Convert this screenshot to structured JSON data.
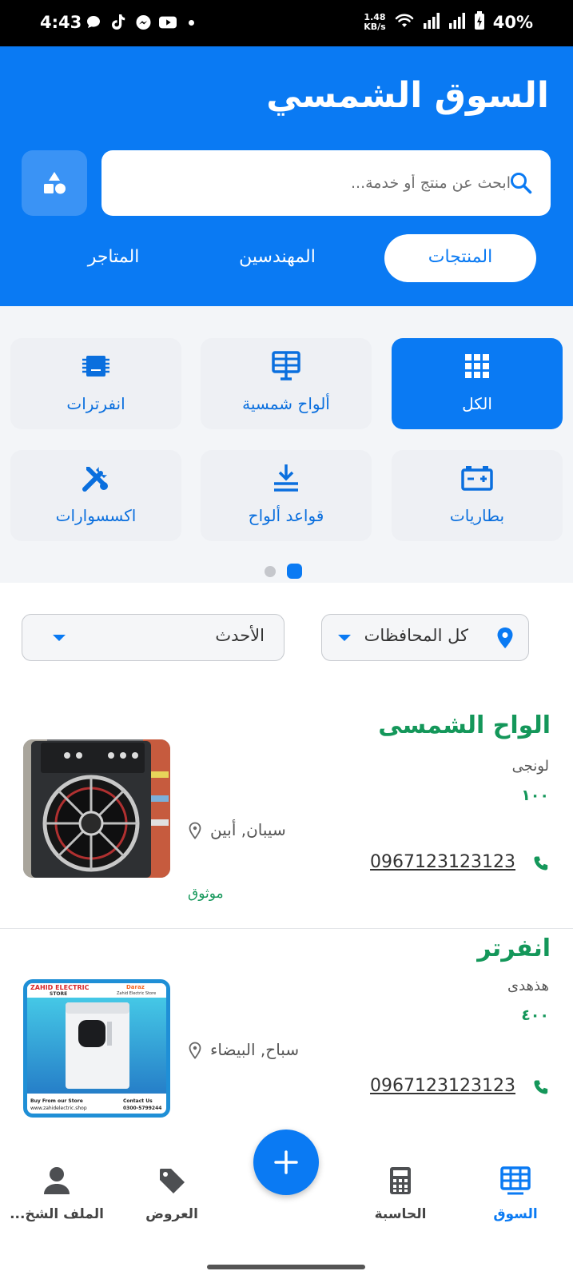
{
  "status_bar": {
    "time": "4:43",
    "speed_value": "1.48",
    "speed_unit": "KB/s",
    "battery": "40%",
    "app_icons": [
      "chat-bubble-icon",
      "tiktok-icon",
      "messenger-icon",
      "youtube-icon"
    ]
  },
  "header": {
    "title": "السوق الشمسي",
    "search_placeholder": "ابحث عن منتج أو خدمة...",
    "tabs": [
      {
        "label": "المنتجات",
        "active": true
      },
      {
        "label": "المهندسين",
        "active": false
      },
      {
        "label": "المتاجر",
        "active": false
      }
    ]
  },
  "categories": [
    {
      "label": "الكل",
      "icon": "grid-icon",
      "active": true
    },
    {
      "label": "ألواح شمسية",
      "icon": "solar-panel-icon",
      "active": false
    },
    {
      "label": "انفرترات",
      "icon": "inverter-chip-icon",
      "active": false
    },
    {
      "label": "بطاريات",
      "icon": "battery-icon",
      "active": false
    },
    {
      "label": "قواعد ألواح",
      "icon": "panel-mount-icon",
      "active": false
    },
    {
      "label": "اكسسوارات",
      "icon": "tools-icon",
      "active": false
    }
  ],
  "filters": {
    "governorate": "كل المحافظات",
    "sort": "الأحدث"
  },
  "listings": [
    {
      "title": "الواح الشمسى",
      "brand": "لونجى",
      "price": "١٠٠",
      "location": "سيبان, أبين",
      "phone": "0967123123123",
      "badge": "موثوق"
    },
    {
      "title": "انفرتر",
      "brand": "هذهدى",
      "price": "٤٠٠",
      "location": "سباح, البيضاء",
      "phone": "0967123123123",
      "thumb_text": {
        "store_name": "ZAHID ELECTRIC",
        "store_sub": "STORE",
        "daraz": "Daraz",
        "daraz_sub": "Zahid Electric Store",
        "buy": "Buy From our Store",
        "site": "www.zahidelectric.shop",
        "contact": "Contact Us",
        "contact_num": "0300-5799244"
      }
    }
  ],
  "bottom_nav": [
    {
      "label": "السوق",
      "icon": "market-grid-icon",
      "active": true
    },
    {
      "label": "الحاسبة",
      "icon": "calculator-icon",
      "active": false
    },
    {
      "label": "العروض",
      "icon": "tag-icon",
      "active": false
    },
    {
      "label": "الملف الشخ...",
      "icon": "profile-icon",
      "active": false
    }
  ],
  "colors": {
    "primary": "#0a7af3",
    "accent_green": "#14975a"
  }
}
